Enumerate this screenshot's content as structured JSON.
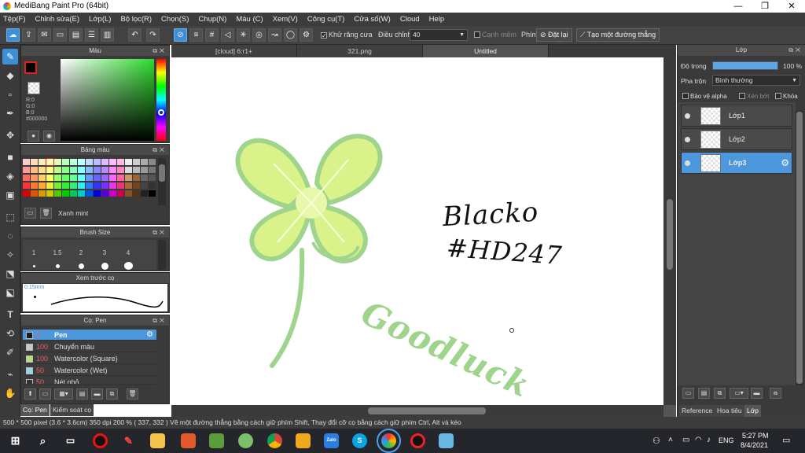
{
  "window": {
    "title": "MediBang Paint Pro (64bit)",
    "min": "—",
    "max": "❐",
    "close": "✕"
  },
  "menu": [
    "Tệp(F)",
    "Chỉnh sửa(E)",
    "Lớp(L)",
    "Bộ lọc(R)",
    "Chọn(S)",
    "Chụp(N)",
    "Màu (C)",
    "Xem(V)",
    "Công cụ(T)",
    "Cửa số(W)",
    "Cloud",
    "Help"
  ],
  "toolbar": {
    "antialias": "Khử răng cưa",
    "adjust_label": "Điều chỉnh",
    "adjust_value": "40",
    "edge": "Cạnh mềm",
    "key_label": "Phím",
    "reset": "Đặt lại",
    "straight": "Tạo một đường thẳng"
  },
  "color_panel": {
    "title": "Màu",
    "r": "R:0",
    "g": "G:0",
    "b": "B:0",
    "hex": "#000000"
  },
  "palette_panel": {
    "title": "Bảng màu",
    "selected_name": "Xanh mint"
  },
  "brushsize_panel": {
    "title": "Brush Size",
    "sizes": [
      "1",
      "1.5",
      "2",
      "3",
      "4"
    ]
  },
  "preview_panel": {
    "title": "Xem trước cọ",
    "size": "0.15mm"
  },
  "brush_panel": {
    "title": "Cọ: Pen",
    "items": [
      {
        "num": "2",
        "name": "Pen",
        "color": "#1d1d1d"
      },
      {
        "num": "100",
        "name": "Chuyển màu",
        "color": "#c8c8c8"
      },
      {
        "num": "100",
        "name": "Watercolor (Square)",
        "color": "#b8e07a"
      },
      {
        "num": "50",
        "name": "Watercolor (Wet)",
        "color": "#8fd8f0"
      },
      {
        "num": "50",
        "name": "Nét nhỏ",
        "color": "#333333"
      }
    ]
  },
  "left_tabs": [
    "Cọ: Pen",
    "Kiểm soát cọ"
  ],
  "doc_tabs": [
    "[cloud] 6:r1+",
    "321.png",
    "Untitled"
  ],
  "canvas_text": {
    "line1": "Blacko",
    "line2": "#HD247",
    "signature": "Goodluck"
  },
  "layer_panel": {
    "title": "Lớp",
    "opacity_label": "Độ trong",
    "opacity_value": "100 %",
    "blend_label": "Pha trộn",
    "blend_value": "Bình thường",
    "protect_alpha": "Bảo vệ alpha",
    "clipping": "Xén bớt",
    "lock": "Khóa",
    "layers": [
      "Lớp1",
      "Lớp2",
      "Lớp3"
    ],
    "tabs": [
      "Reference",
      "Hoa tiêu",
      "Lớp"
    ]
  },
  "status": {
    "text": "500 * 500 pixel   (3.6 * 3.6cm)   350 dpi   200 %   ( 337, 332 )   Vẽ một đường thẳng bằng cách giữ phím Shift, Thay đổi cỡ cọ bằng cách giữ phím Ctrl, Alt và kéo"
  },
  "taskbar": {
    "time": "5:27 PM",
    "date": "8/4/2021",
    "lang": "ENG"
  },
  "colors": {
    "accent": "#3d8fd8",
    "clover_fill": "#d9f28a",
    "clover_edge": "#9fd48c"
  }
}
